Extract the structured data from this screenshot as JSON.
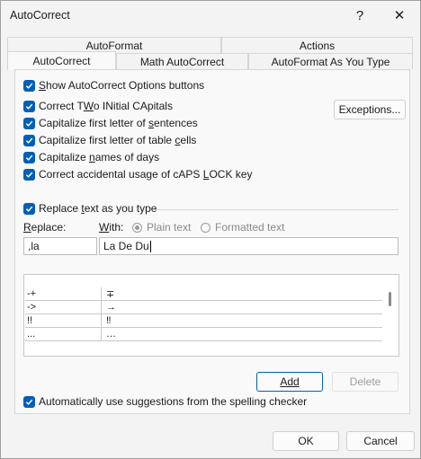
{
  "window": {
    "title": "AutoCorrect",
    "help": "?",
    "close": "✕"
  },
  "tabs_back": [
    "AutoFormat",
    "Actions"
  ],
  "tabs_front": [
    "AutoCorrect",
    "Math AutoCorrect",
    "AutoFormat As You Type"
  ],
  "active_tab": "AutoCorrect",
  "options": {
    "show_buttons": {
      "pre": "",
      "u": "S",
      "post": "how AutoCorrect Options buttons",
      "checked": true
    },
    "two_initial": {
      "pre": "Correct T",
      "u": "W",
      "post": "o INitial CApitals",
      "checked": true
    },
    "first_letter_sentences": {
      "pre": "Capitalize first letter of ",
      "u": "s",
      "post": "entences",
      "checked": true
    },
    "first_letter_table": {
      "pre": "Capitalize first letter of table ",
      "u": "c",
      "post": "ells",
      "checked": true
    },
    "names_days": {
      "pre": "Capitalize ",
      "u": "n",
      "post": "ames of days",
      "checked": true
    },
    "caps_lock": {
      "pre": "Correct accidental usage of cAPS ",
      "u": "L",
      "post": "OCK key",
      "checked": true
    }
  },
  "exceptions_button": "Exceptions...",
  "replace_as_type": {
    "pre": "Replace ",
    "u": "t",
    "post": "ext as you type",
    "checked": true
  },
  "replace_label": {
    "u": "R",
    "post": "eplace:"
  },
  "with_label": {
    "u": "W",
    "post": "ith:"
  },
  "plain_text": "Plain text",
  "formatted_text": "Formatted text",
  "replace_value": ",la",
  "with_value": "La De Du",
  "entries": [
    {
      "replace": "-+",
      "with": "∓"
    },
    {
      "replace": "->",
      "with": "→"
    },
    {
      "replace": "!!",
      "with": "‼"
    },
    {
      "replace": "...",
      "with": "…"
    }
  ],
  "add_button": "Add",
  "delete_button": "Delete",
  "spelling_suggestions": {
    "text": "Automatically use suggestions from the spelling checker",
    "checked": true
  },
  "ok_button": "OK",
  "cancel_button": "Cancel",
  "colors": {
    "accent": "#005fb8"
  }
}
